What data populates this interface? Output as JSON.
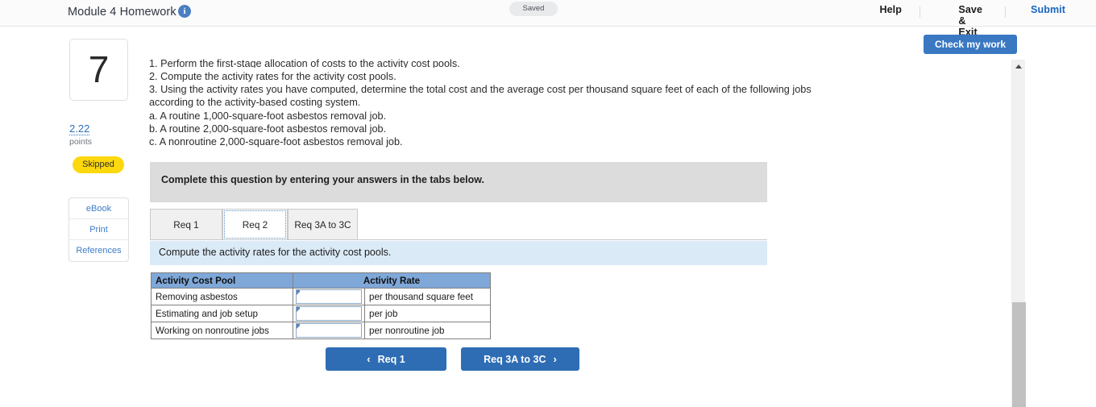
{
  "header": {
    "title": "Module 4 Homework",
    "info_icon": "info-icon",
    "status_pill": "Saved",
    "help_label": "Help",
    "save_exit_label": "Save & Exit",
    "submit_label": "Submit"
  },
  "toolbar": {
    "check_my_work_label": "Check my work"
  },
  "left_rail": {
    "question_number": "7",
    "points_value": "2.22",
    "points_label": "points",
    "status_badge": "Skipped",
    "links": [
      {
        "label": "eBook"
      },
      {
        "label": "Print"
      },
      {
        "label": "References"
      }
    ]
  },
  "question": {
    "lines": [
      "1. Perform the first-stage allocation of costs to the activity cost pools.",
      "2. Compute the activity rates for the activity cost pools.",
      "3. Using the activity rates you have computed, determine the total cost and the average cost per thousand square feet of each of the following jobs according to the activity-based costing system.",
      "a. A routine 1,000-square-foot asbestos removal job.",
      "b. A routine 2,000-square-foot asbestos removal job.",
      "c. A nonroutine 2,000-square-foot asbestos removal job."
    ],
    "complete_instruction": "Complete this question by entering your answers in the tabs below."
  },
  "tabs": [
    {
      "label": "Req 1",
      "active": false
    },
    {
      "label": "Req 2",
      "active": true
    },
    {
      "label": "Req 3A to 3C",
      "active": false
    }
  ],
  "requirement": {
    "prompt": "Compute the activity rates for the activity cost pools."
  },
  "table": {
    "headers": [
      "Activity Cost Pool",
      "Activity Rate"
    ],
    "rows": [
      {
        "pool": "Removing asbestos",
        "rate_value": "",
        "unit": "per thousand square feet"
      },
      {
        "pool": "Estimating and job setup",
        "rate_value": "",
        "unit": "per job"
      },
      {
        "pool": "Working on nonroutine jobs",
        "rate_value": "",
        "unit": "per nonroutine job"
      }
    ]
  },
  "nav": {
    "prev_label": "Req 1",
    "next_label": "Req 3A to 3C",
    "prev_chevron": "‹",
    "next_chevron": "›"
  }
}
